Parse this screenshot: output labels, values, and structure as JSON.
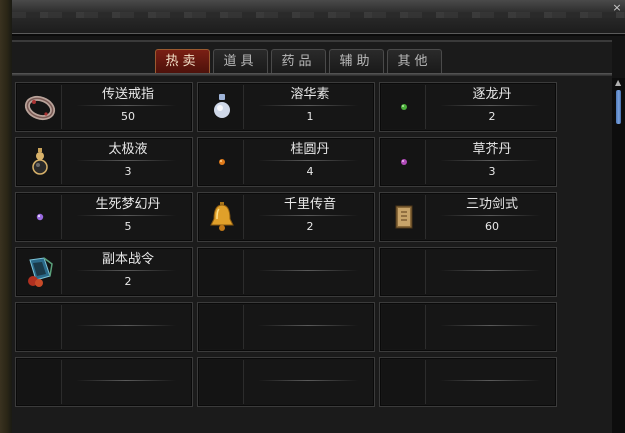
{
  "window": {
    "close_label": "×"
  },
  "tabs": [
    {
      "label": "热卖",
      "active": true
    },
    {
      "label": "道具",
      "active": false
    },
    {
      "label": "药品",
      "active": false
    },
    {
      "label": "辅助",
      "active": false
    },
    {
      "label": "其他",
      "active": false
    }
  ],
  "items": [
    {
      "name": "传送戒指",
      "qty": "50",
      "icon": "ring-icon"
    },
    {
      "name": "溶华素",
      "qty": "1",
      "icon": "potion-bottle-icon"
    },
    {
      "name": "逐龙丹",
      "qty": "2",
      "icon": "green-pill-icon"
    },
    {
      "name": "太极液",
      "qty": "3",
      "icon": "gourd-flask-icon"
    },
    {
      "name": "桂圆丹",
      "qty": "4",
      "icon": "orange-pill-icon"
    },
    {
      "name": "草芥丹",
      "qty": "3",
      "icon": "purple-pill-icon"
    },
    {
      "name": "生死梦幻丹",
      "qty": "5",
      "icon": "violet-pill-icon"
    },
    {
      "name": "千里传音",
      "qty": "2",
      "icon": "bell-icon"
    },
    {
      "name": "三功剑式",
      "qty": "60",
      "icon": "scroll-book-icon"
    },
    {
      "name": "副本战令",
      "qty": "2",
      "icon": "battle-token-icon"
    },
    {
      "name": "",
      "qty": "",
      "icon": ""
    },
    {
      "name": "",
      "qty": "",
      "icon": ""
    },
    {
      "name": "",
      "qty": "",
      "icon": ""
    },
    {
      "name": "",
      "qty": "",
      "icon": ""
    },
    {
      "name": "",
      "qty": "",
      "icon": ""
    },
    {
      "name": "",
      "qty": "",
      "icon": ""
    },
    {
      "name": "",
      "qty": "",
      "icon": ""
    },
    {
      "name": "",
      "qty": "",
      "icon": ""
    }
  ],
  "colors": {
    "active_tab": "#6a1a10",
    "text": "#e8e8e8",
    "scroll_thumb": "#5f8ccc"
  }
}
